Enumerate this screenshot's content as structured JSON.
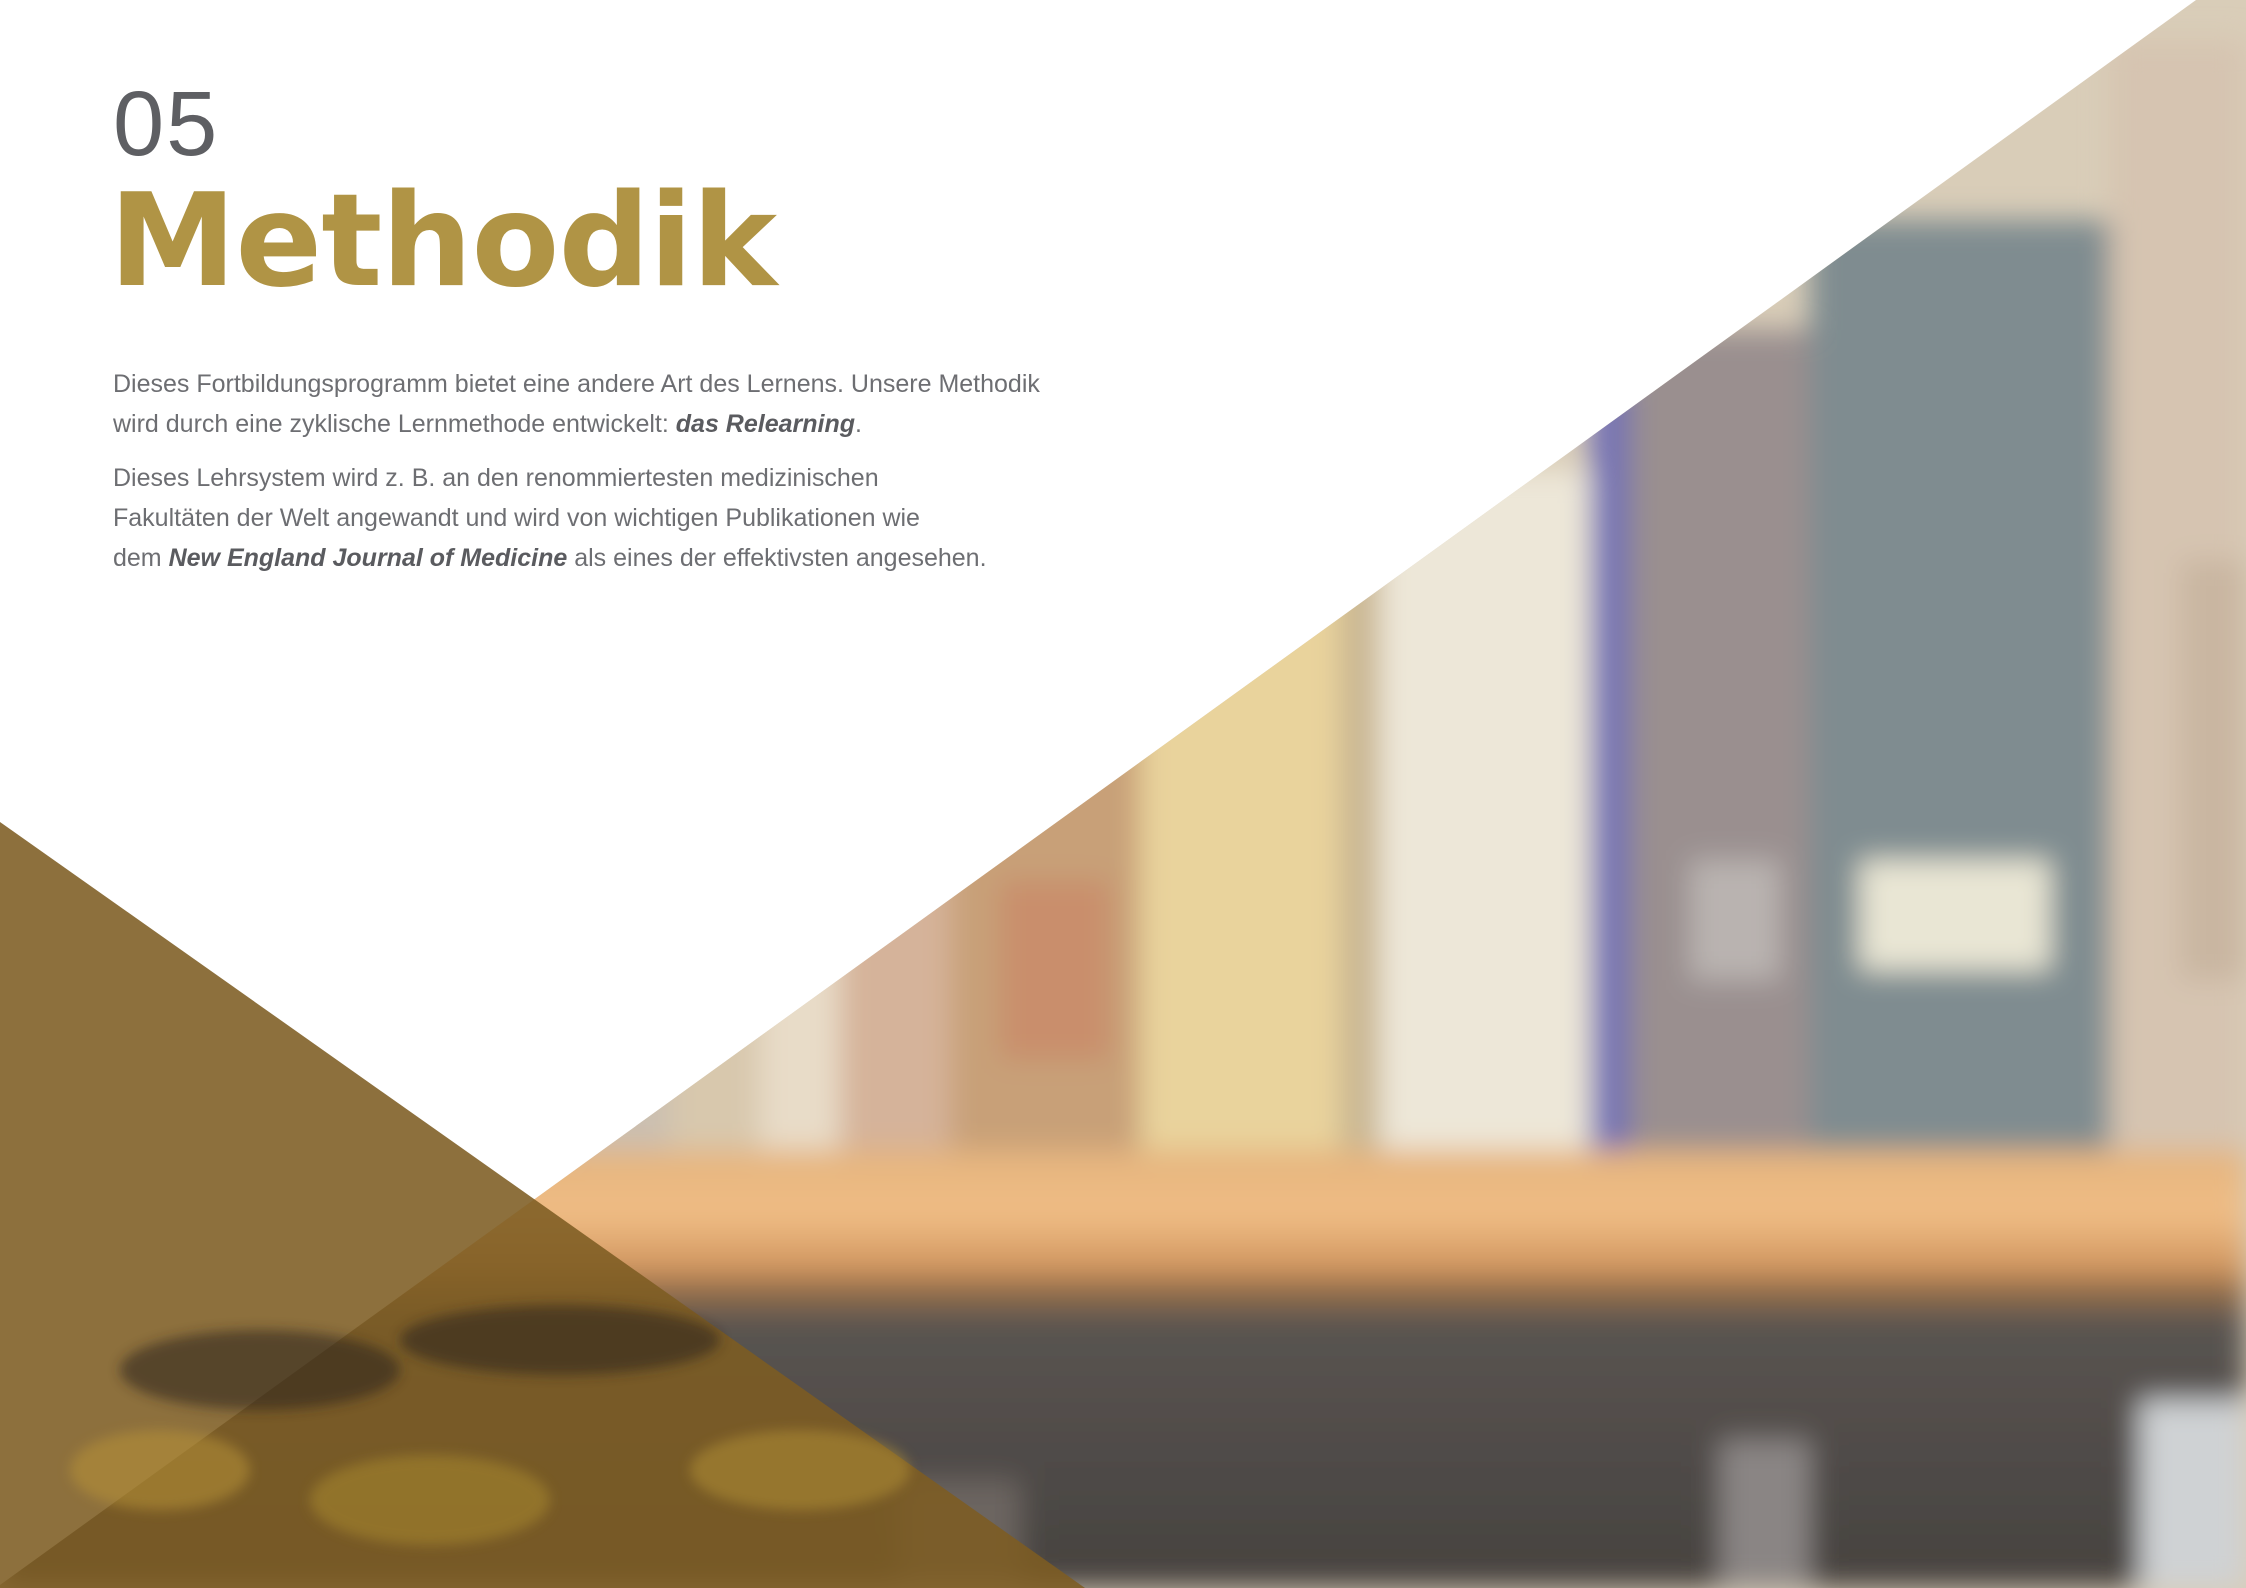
{
  "section": {
    "number": "05",
    "title": "Methodik"
  },
  "body": {
    "p1_line1": "Dieses Fortbildungsprogramm bietet eine andere Art des Lernens. Unsere Methodik",
    "p1_line2_before": "wird durch eine zyklische Lernmethode entwickelt: ",
    "p1_line2_emphasis": "das Relearning",
    "p1_line2_after": ".",
    "p2_line1": "Dieses Lehrsystem wird z. B. an den renommiertesten medizinischen",
    "p2_line2": "Fakultäten der Welt angewandt und wird von wichtigen Publikationen wie",
    "p2_line3_before": "dem ",
    "p2_line3_emphasis": "New England Journal of Medicine",
    "p2_line3_after": " als eines der effektivsten angesehen."
  },
  "colors": {
    "accent_gold": "#b09445",
    "text_gray": "#6d6e72",
    "number_gray": "#5e5f63",
    "overlay_brown": "#8a6a2e"
  },
  "illustration": {
    "subject": "blurred-bookshelf-photo"
  }
}
